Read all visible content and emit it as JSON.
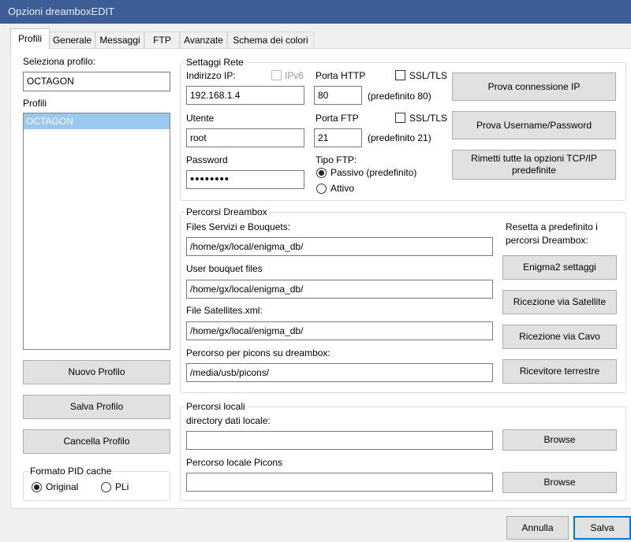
{
  "window": {
    "title": "Opzioni dreamboxEDIT"
  },
  "tabs": [
    {
      "label": "Profili",
      "active": true
    },
    {
      "label": "Generale"
    },
    {
      "label": "Messaggi"
    },
    {
      "label": "FTP"
    },
    {
      "label": "Avanzate"
    },
    {
      "label": "Schema dei colori"
    }
  ],
  "profile": {
    "select_label": "Seleziona profilo:",
    "select_value": "OCTAGON",
    "list_label": "Profili",
    "list_items": [
      "OCTAGON"
    ],
    "new_button": "Nuovo Profilo",
    "save_button": "Salva Profilo",
    "delete_button": "Cancella Profilo"
  },
  "pid_cache": {
    "title": "Formato PID cache",
    "option_original": "Original",
    "option_pli": "PLi",
    "selected": "Original"
  },
  "network": {
    "title": "Settaggi Rete",
    "ip_label": "Indirizzo IP:",
    "ipv6_label": "IPv6",
    "ip_value": "192.168.1.4",
    "http_port_label": "Porta HTTP",
    "http_ssl_label": "SSL/TLS",
    "http_port_value": "80",
    "http_default": "(predefinito 80)",
    "user_label": "Utente",
    "user_value": "root",
    "ftp_port_label": "Porta FTP",
    "ftp_ssl_label": "SSL/TLS",
    "ftp_port_value": "21",
    "ftp_default": "(predefinito 21)",
    "password_label": "Password",
    "password_value": "••••••••",
    "ftp_type_label": "Tipo FTP:",
    "ftp_passive": "Passivo (predefinito)",
    "ftp_active": "Attivo",
    "ftp_type_selected": "Passivo",
    "test_ip_button": "Prova connessione IP",
    "test_user_button": "Prova Username/Password",
    "reset_tcp_button": "Rimetti tutte la opzioni TCP/IP predefinite"
  },
  "dreambox_paths": {
    "title": "Percorsi Dreambox",
    "services_label": "Files Servizi e Bouquets:",
    "services_value": "/home/gx/local/enigma_db/",
    "userbouquet_label": "User bouquet files",
    "userbouquet_value": "/home/gx/local/enigma_db/",
    "satellites_label": "File Satellites.xml:",
    "satellites_value": "/home/gx/local/enigma_db/",
    "picons_label": "Percorso per picons su dreambox:",
    "picons_value": "/media/usb/picons/",
    "reset_label": "Resetta a predefinito i percorsi Dreambox:",
    "enigma2_button": "Enigma2 settaggi",
    "satellite_button": "Ricezione via Satellite",
    "cable_button": "Ricezione via Cavo",
    "terrestrial_button": "Ricevitore terrestre"
  },
  "local_paths": {
    "title": "Percorsi locali",
    "data_dir_label": "directory dati locale:",
    "data_dir_value": "",
    "picons_label": "Percorso locale Picons",
    "picons_value": "",
    "browse_button_1": "Browse",
    "browse_button_2": "Browse"
  },
  "footer": {
    "cancel_button": "Annulla",
    "save_button": "Salva"
  }
}
